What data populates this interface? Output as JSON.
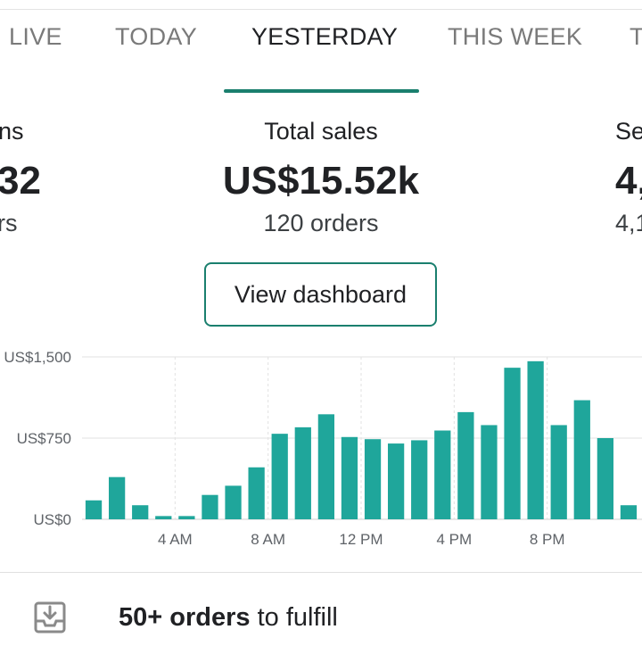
{
  "tabs": [
    {
      "label": "LIVE"
    },
    {
      "label": "TODAY"
    },
    {
      "label": "YESTERDAY",
      "active": true
    },
    {
      "label": "THIS WEEK"
    },
    {
      "label": "T"
    }
  ],
  "stats": {
    "left": {
      "label": "ns",
      "value": "32",
      "sub": "rs"
    },
    "center": {
      "label": "Total sales",
      "value": "US$15.52k",
      "sub": "120 orders"
    },
    "right": {
      "label": "Se",
      "value": "4,",
      "sub": "4,1"
    }
  },
  "dashboard_button": "View dashboard",
  "colors": {
    "accent": "#1a7f6e",
    "bar": "#1fa69b"
  },
  "chart_data": {
    "type": "bar",
    "ylim": [
      0,
      1500
    ],
    "yticks": [
      "US$0",
      "US$750",
      "US$1,500"
    ],
    "xtick_labels": [
      "4 AM",
      "8 AM",
      "12 PM",
      "4 PM",
      "8 PM"
    ],
    "categories": [
      "0",
      "1",
      "2",
      "3",
      "4",
      "5",
      "6",
      "7",
      "8",
      "9",
      "10",
      "11",
      "12",
      "13",
      "14",
      "15",
      "16",
      "17",
      "18",
      "19",
      "20",
      "21",
      "22",
      "23"
    ],
    "values": [
      175,
      390,
      130,
      30,
      30,
      225,
      310,
      480,
      790,
      850,
      970,
      760,
      740,
      700,
      730,
      820,
      990,
      870,
      1400,
      1460,
      870,
      1100,
      750,
      130
    ],
    "grid": true
  },
  "fulfill": {
    "bold": "50+ orders",
    "rest": " to fulfill",
    "icon": "inbox-download-icon"
  }
}
